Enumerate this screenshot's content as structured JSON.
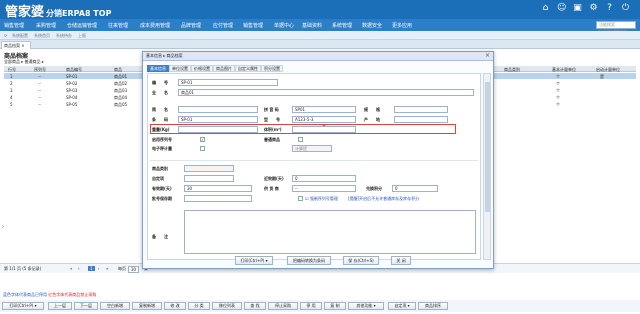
{
  "header": {
    "brand": "管家婆",
    "edition": "分销ERPA8 TOP",
    "menu": [
      "销售管理",
      "采购管理",
      "仓储运输管理",
      "往来管理",
      "成本费用管理",
      "品牌管理",
      "应付管理",
      "销售管理",
      "单据中心",
      "基础资料",
      "系统管理",
      "数据安全",
      "更多应用"
    ],
    "search_placeholder": "功能搜索(Ctrl+Shift+F)"
  },
  "breadcrumbs": [
    "系统配置",
    "系统首页",
    "系统待办",
    "上报"
  ],
  "page_tab": "商品档案",
  "list": {
    "title": "商品档案",
    "filter": "全部商品 ▸ 普通商品 ▸",
    "columns": [
      "行号",
      "序列号",
      "商品编号",
      "商品"
    ],
    "right_columns": [
      "商品类别",
      "基本计量单位",
      "启动计量单位"
    ],
    "rows": [
      {
        "no": "1",
        "sn": "--",
        "code": "SP-01",
        "name": "商品01",
        "unit": "个",
        "flag": "是"
      },
      {
        "no": "2",
        "sn": "--",
        "code": "SP-02",
        "name": "商品02",
        "unit": "个",
        "flag": ""
      },
      {
        "no": "3",
        "sn": "--",
        "code": "SP-03",
        "name": "商品03",
        "unit": "个",
        "flag": ""
      },
      {
        "no": "4",
        "sn": "--",
        "code": "SP-04",
        "name": "商品04",
        "unit": "个",
        "flag": ""
      },
      {
        "no": "5",
        "sn": "--",
        "code": "SP-05",
        "name": "商品05",
        "unit": "个",
        "flag": ""
      }
    ]
  },
  "pager": {
    "info": "第 1/1 页 (5 条记录)",
    "per_page_label": "每页",
    "per_page": "30",
    "unit": "条"
  },
  "notes": {
    "blue": "蓝色字体代表商品已停用",
    "red": "红色字体代表商品禁止采购"
  },
  "bottom_buttons": [
    "打印(Ctrl+P) ▾",
    "上一层",
    "下一层",
    "空白新增",
    "复制新增",
    "修 改",
    "分 类",
    "移位列表",
    "查 找",
    "停止采购",
    "停 用",
    "复 制",
    "其他功能 ▾",
    "自定项 ▾",
    "商品排序"
  ],
  "dialog": {
    "title": "基本信息 ▸ 商品档案",
    "tabs": [
      "基本信息",
      "单位设置",
      "价格设置",
      "商品图片",
      "自定义属性",
      "积分设置"
    ],
    "labels": {
      "code": "编　　号",
      "full_name": "全　　名",
      "short_name": "简　　名",
      "pinyin": "拼 音 码",
      "spec": "规　　格",
      "barcode": "条　　码",
      "model": "型　　号",
      "origin": "产　　地",
      "weight": "重量(Kg)",
      "volume": "体积(m³)",
      "serial": "启用序列号",
      "scale": "电子秤计量",
      "normal_goods": "普通商品",
      "category": "商品类别",
      "custom": "自定项",
      "shelf_life": "有效期(天)",
      "supplier": "供 货 商",
      "warn_days": "近效期(天)",
      "min_days": "批号保存期",
      "points": "兑换积分",
      "remark": "备　　注"
    },
    "values": {
      "code": "SP-01",
      "full_name": "商品01",
      "pinyin": "SP01",
      "barcode": "SP-01",
      "model": "A123-5-3",
      "shelf_life": "30",
      "warn_days": "0",
      "points": "0",
      "tax_type": "计算提",
      "supplier": "--"
    },
    "serial_check": "☑ 强制序列号管理",
    "link_text": "[提醒]开启后不允许普通库存及库存积分",
    "buttons": [
      "打印(Ctrl+P) ▾",
      "把编码转换为条码",
      "保 存(Ctrl+S)",
      "关 闭"
    ]
  }
}
